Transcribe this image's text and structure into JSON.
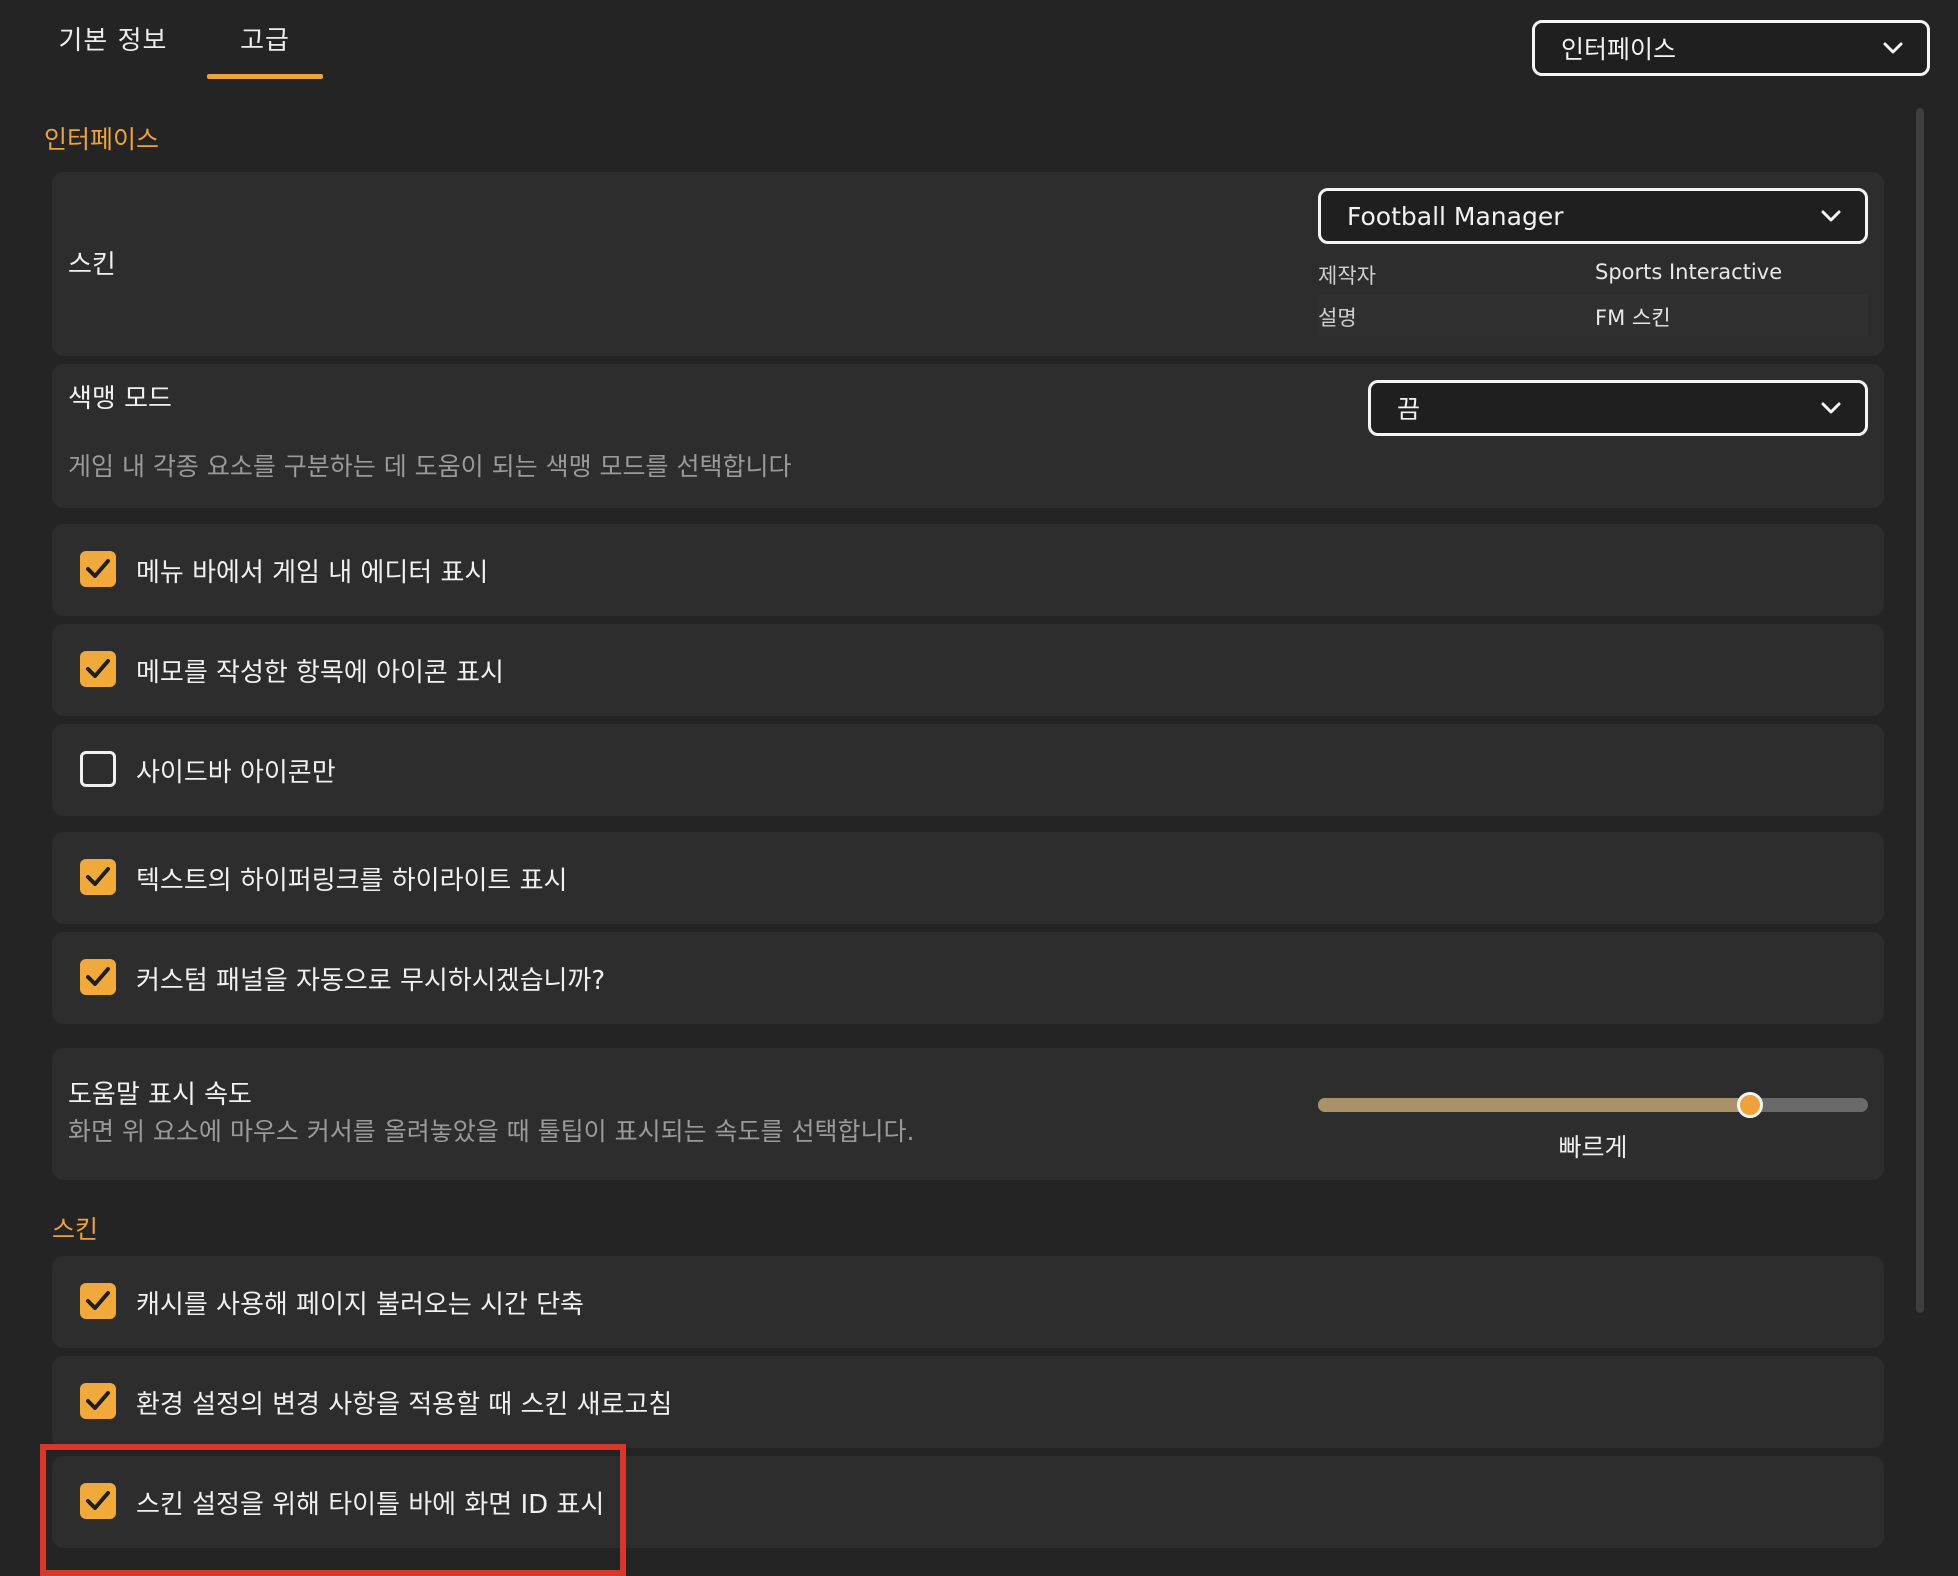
{
  "tabs": [
    {
      "label": "기본 정보",
      "active": false
    },
    {
      "label": "고급",
      "active": true
    }
  ],
  "category_select": {
    "value": "인터페이스"
  },
  "sections": {
    "interface": "인터페이스",
    "skin": "스킨"
  },
  "skin": {
    "title": "스킨",
    "select_value": "Football Manager",
    "meta": [
      {
        "key": "제작자",
        "value": "Sports Interactive"
      },
      {
        "key": "설명",
        "value": "FM 스킨"
      }
    ]
  },
  "colorblind": {
    "title": "색맹 모드",
    "description": "게임 내 각종 요소를 구분하는 데 도움이 되는 색맹 모드를 선택합니다",
    "select_value": "끔"
  },
  "interface_options": [
    {
      "label": "메뉴 바에서 게임 내 에디터 표시",
      "checked": true
    },
    {
      "label": "메모를 작성한 항목에 아이콘 표시",
      "checked": true
    },
    {
      "label": "사이드바 아이콘만",
      "checked": false
    },
    {
      "label": "텍스트의 하이퍼링크를 하이라이트 표시",
      "checked": true
    },
    {
      "label": "커스텀 패널을 자동으로 무시하시겠습니까?",
      "checked": true
    }
  ],
  "tooltip_speed": {
    "title": "도움말 표시 속도",
    "description": "화면 위 요소에 마우스 커서를 올려놓았을 때 툴팁이 표시되는 속도를 선택합니다.",
    "value_label": "빠르게",
    "level": 0.785
  },
  "skin_options": [
    {
      "label": "캐시를 사용해 페이지 불러오는 시간 단축",
      "checked": true
    },
    {
      "label": "환경 설정의 변경 사항을 적용할 때 스킨 새로고침",
      "checked": true
    },
    {
      "label": "스킨 설정을 위해 타이틀 바에 화면 ID 표시",
      "checked": true
    }
  ],
  "colors": {
    "accent": "#f0a23a",
    "background": "#242424",
    "card": "#2d2d2d",
    "highlight": "#d6382a"
  }
}
